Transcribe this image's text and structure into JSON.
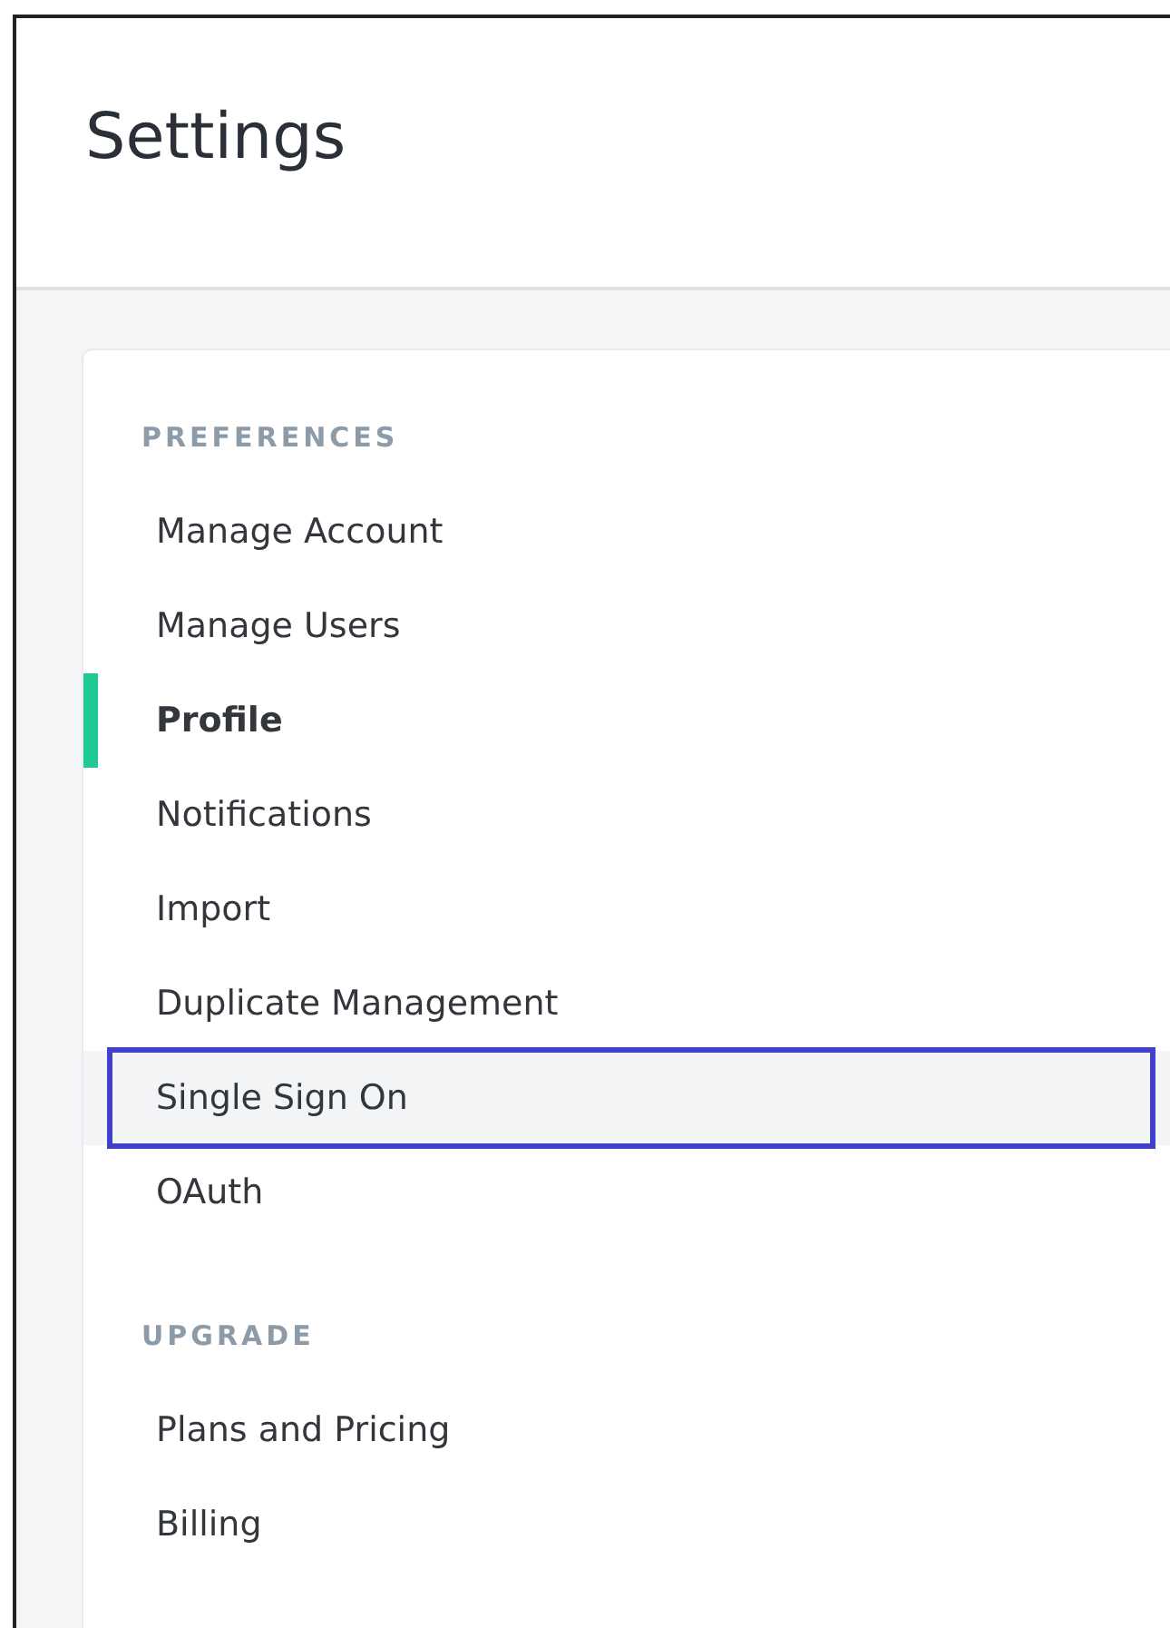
{
  "header": {
    "title": "Settings"
  },
  "sections": [
    {
      "heading": "PREFERENCES",
      "items": [
        {
          "label": "Manage Account",
          "selected": false,
          "highlighted": false
        },
        {
          "label": "Manage Users",
          "selected": false,
          "highlighted": false
        },
        {
          "label": "Profile",
          "selected": true,
          "highlighted": false
        },
        {
          "label": "Notifications",
          "selected": false,
          "highlighted": false
        },
        {
          "label": "Import",
          "selected": false,
          "highlighted": false
        },
        {
          "label": "Duplicate Management",
          "selected": false,
          "highlighted": false
        },
        {
          "label": "Single Sign On",
          "selected": false,
          "highlighted": true
        },
        {
          "label": "OAuth",
          "selected": false,
          "highlighted": false
        }
      ]
    },
    {
      "heading": "UPGRADE",
      "items": [
        {
          "label": "Plans and Pricing",
          "selected": false,
          "highlighted": false
        },
        {
          "label": "Billing",
          "selected": false,
          "highlighted": false
        }
      ]
    }
  ]
}
